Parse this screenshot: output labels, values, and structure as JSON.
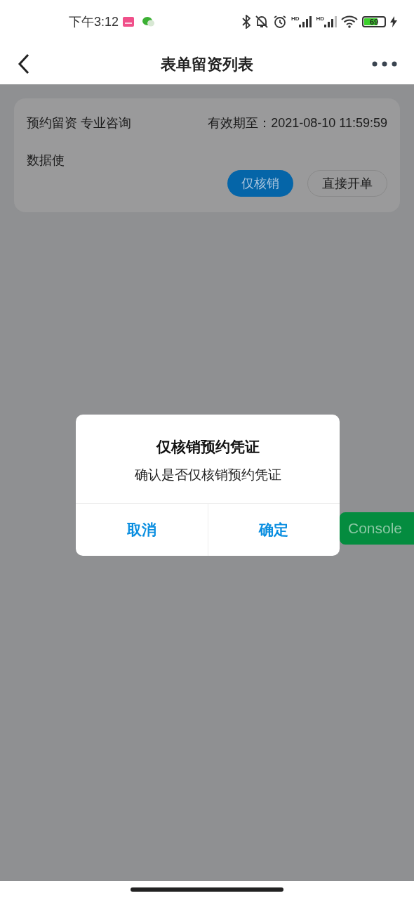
{
  "status_bar": {
    "time": "下午3:12",
    "signals": [
      {
        "label": "HD"
      },
      {
        "label": "HD"
      }
    ],
    "battery": "69"
  },
  "header": {
    "title": "表单留资列表"
  },
  "card": {
    "title": "预约留资 专业咨询",
    "expiry": "有效期至：2021-08-10 11:59:59",
    "note": "数据使",
    "buttons": [
      {
        "label": "仅核销",
        "kind": "primary"
      },
      {
        "label": "直接开单",
        "kind": "outline"
      }
    ]
  },
  "dialog": {
    "title": "仅核销预约凭证",
    "message": "确认是否仅核销预约凭证",
    "buttons": [
      "取消",
      "确定"
    ]
  },
  "console_button": {
    "label": "Console"
  }
}
